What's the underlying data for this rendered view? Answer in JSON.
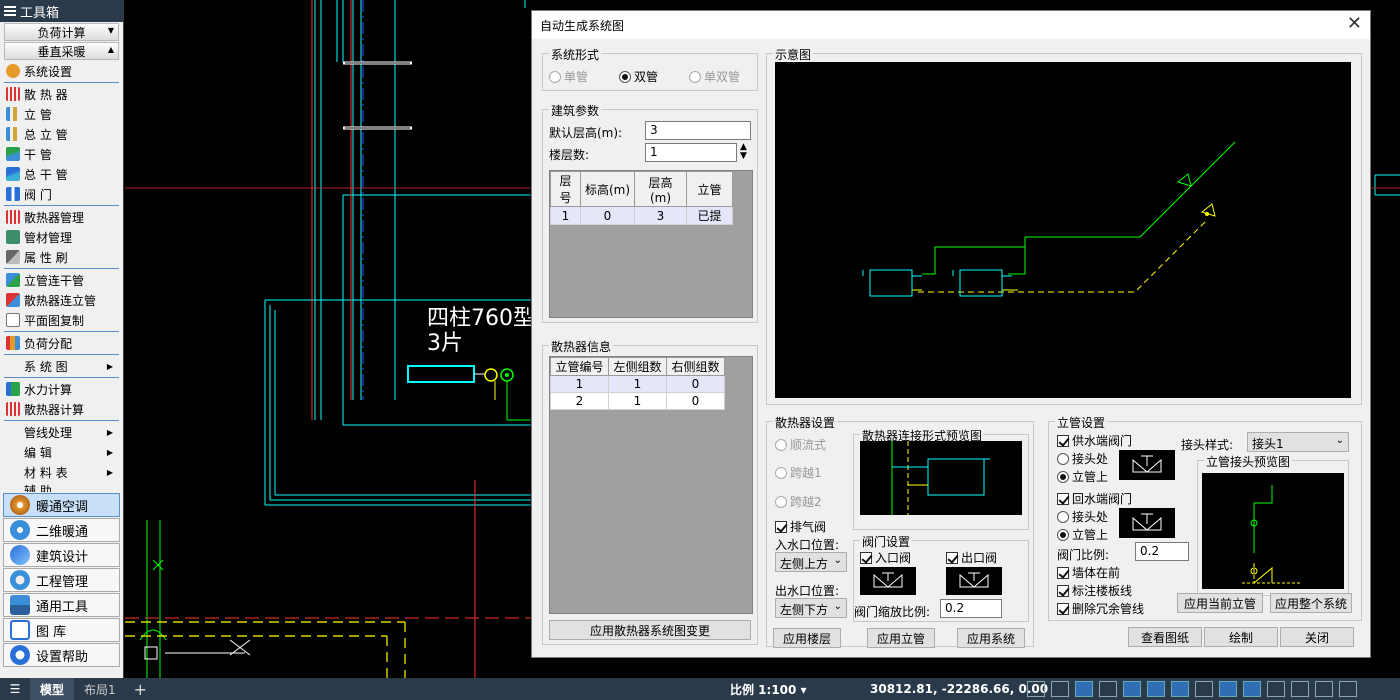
{
  "toolbox": {
    "title": "工具箱",
    "sections": [
      "负荷计算",
      "垂直采暖"
    ],
    "items_a": [
      "系统设置",
      "散 热 器",
      "立    管",
      "总 立 管",
      "干    管",
      "总 干 管",
      "阀    门"
    ],
    "items_b": [
      "散热器管理",
      "管材管理",
      "属 性 刷"
    ],
    "items_c": [
      "立管连干管",
      "散热器连立管",
      "平面图复制"
    ],
    "items_d": [
      "负荷分配"
    ],
    "sub_a": "系 统 图",
    "items_e": [
      "水力计算",
      "散热器计算"
    ],
    "subs": [
      "管线处理",
      "编    辑",
      "材 料 表",
      "辅    助"
    ],
    "big": [
      "暖通空调",
      "二维暖通",
      "建筑设计",
      "工程管理",
      "通用工具",
      "图    库",
      "设置帮助"
    ]
  },
  "cad": {
    "label_line1": "四柱760型",
    "label_line2": "3片"
  },
  "status": {
    "tab_model": "模型",
    "tab_layout": "布局1",
    "plus": "+",
    "scale": "比例 1:100 ▾",
    "coords": "30812.81, -22286.66, 0.00"
  },
  "dialog": {
    "title": "自动生成系统图",
    "close": "✕",
    "system_form": {
      "legend": "系统形式",
      "options": [
        "单管",
        "双管",
        "单双管"
      ],
      "selected": "双管"
    },
    "building": {
      "legend": "建筑参数",
      "floor_height_label": "默认层高(m):",
      "floor_height_value": "3",
      "floor_count_label": "楼层数:",
      "floor_count_value": "1",
      "columns": [
        "层号",
        "标高(m)",
        "层高(m)",
        "立管"
      ],
      "rows": [
        [
          "1",
          "0",
          "3",
          "已提"
        ]
      ]
    },
    "radiator_info": {
      "legend": "散热器信息",
      "columns": [
        "立管编号",
        "左侧组数",
        "右侧组数"
      ],
      "rows": [
        [
          "1",
          "1",
          "0"
        ],
        [
          "2",
          "1",
          "0"
        ]
      ],
      "apply_button": "应用散热器系统图变更"
    },
    "schematic": {
      "legend": "示意图"
    },
    "radiator_settings": {
      "legend": "散热器设置",
      "flow_options": [
        "顺流式",
        "跨越1",
        "跨越2"
      ],
      "vent_valve": "排气阀",
      "inlet_label": "入水口位置:",
      "inlet_value": "左侧上方",
      "outlet_label": "出水口位置:",
      "outlet_value": "左侧下方",
      "preview_legend": "散热器连接形式预览图",
      "valve_legend": "阀门设置",
      "inlet_valve": "入口阀",
      "outlet_valve": "出口阀",
      "valve_scale_label": "阀门缩放比例:",
      "valve_scale_value": "0.2",
      "btn_apply_floor": "应用楼层",
      "btn_apply_riser": "应用立管",
      "btn_apply_system": "应用系统"
    },
    "riser_settings": {
      "legend": "立管设置",
      "supply_valve": "供水端阀门",
      "joint_style_label": "接头样式:",
      "joint_style_value": "接头1",
      "opt_joint": "接头处",
      "opt_riser": "立管上",
      "preview_legend": "立管接头预览图",
      "return_valve": "回水端阀门",
      "valve_ratio_label": "阀门比例:",
      "valve_ratio_value": "0.2",
      "wall_front": "墙体在前",
      "mark_floor": "标注楼板线",
      "delete_redundant": "删除冗余管线",
      "btn_apply_current": "应用当前立管",
      "btn_apply_whole": "应用整个系统"
    },
    "footer": {
      "view": "查看图纸",
      "draw": "绘制",
      "close": "关闭"
    }
  },
  "colors": {
    "cad_bg": "#000000",
    "cyan": "#00ffff",
    "green": "#00ff00",
    "yellow": "#ffff00",
    "toolbar_dark": "#2b3a4a"
  }
}
